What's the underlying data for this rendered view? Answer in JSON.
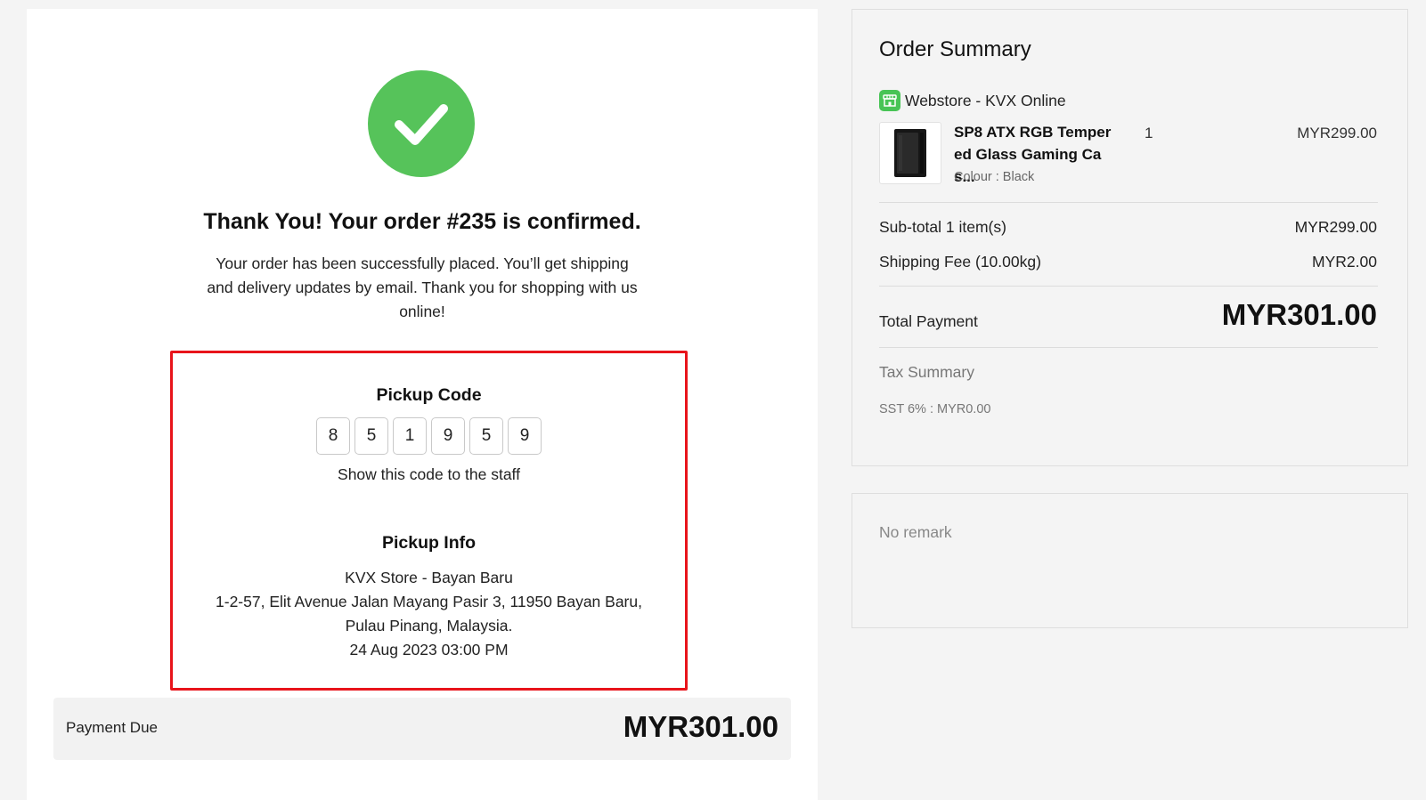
{
  "confirmation": {
    "title": "Thank You! Your order #235 is confirmed.",
    "message": "Your order has been successfully placed. You’ll get shipping and delivery updates by email. Thank you for shopping with us online!",
    "icon": "check-circle-icon",
    "icon_color": "#56c35a"
  },
  "pickup": {
    "code_title": "Pickup Code",
    "code_digits": [
      "8",
      "5",
      "1",
      "9",
      "5",
      "9"
    ],
    "hint": "Show this code to the staff",
    "info_title": "Pickup Info",
    "store": "KVX Store - Bayan Baru",
    "address_line1": "1-2-57, Elit Avenue Jalan Mayang Pasir 3, 11950 Bayan Baru,",
    "address_line2": "Pulau Pinang, Malaysia.",
    "datetime": "24 Aug 2023 03:00 PM",
    "highlight_color": "#e8141b"
  },
  "payment_due": {
    "label": "Payment Due",
    "amount": "MYR301.00"
  },
  "order_summary": {
    "title": "Order Summary",
    "store_name": "Webstore - KVX Online",
    "store_icon": "store-icon",
    "item": {
      "name": "SP8 ATX RGB Temper ed Glass Gaming Cas...",
      "variant": "Colour : Black",
      "quantity": "1",
      "price": "MYR299.00"
    },
    "subtotal_label": "Sub-total 1 item(s)",
    "subtotal_value": "MYR299.00",
    "shipping_label": "Shipping Fee (10.00kg)",
    "shipping_value": "MYR2.00",
    "total_label": "Total Payment",
    "total_value": "MYR301.00",
    "tax_title": "Tax Summary",
    "tax_line": "SST 6% : MYR0.00"
  },
  "remark": {
    "text": "No remark"
  }
}
